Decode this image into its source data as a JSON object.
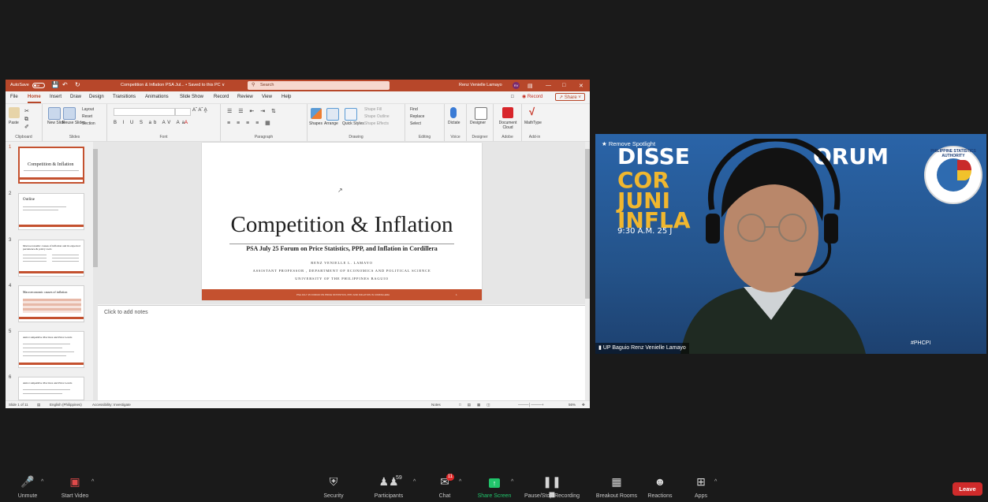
{
  "ppt": {
    "titlebar": {
      "autosave": "AutoSave",
      "autosave_state": "Off",
      "document_title": "Competition & Inflation PSA Jul... • Saved to this PC ∨",
      "search_placeholder": "Search",
      "user_name": "Renz Venielle Lamayo",
      "user_initials": "RV"
    },
    "menu_tabs": [
      "File",
      "Home",
      "Insert",
      "Draw",
      "Design",
      "Transitions",
      "Animations",
      "Slide Show",
      "Record",
      "Review",
      "View",
      "Help"
    ],
    "record_label": "Record",
    "share_label": "Share",
    "ribbon": {
      "paste": "Paste",
      "new_slide": "New Slide",
      "reuse_slides": "Reuse Slides",
      "layout": "Layout",
      "reset": "Reset",
      "section": "Section",
      "shapes": "Shapes",
      "arrange": "Arrange",
      "quick_styles": "Quick Styles",
      "shape_fill": "Shape Fill",
      "shape_outline": "Shape Outline",
      "shape_effects": "Shape Effects",
      "find": "Find",
      "replace": "Replace",
      "select": "Select",
      "dictate": "Dictate",
      "designer": "Designer",
      "document_cloud": "Document Cloud",
      "mathtype": "MathType",
      "groups": [
        "Clipboard",
        "Slides",
        "Font",
        "Paragraph",
        "Drawing",
        "Editing",
        "Voice",
        "Designer",
        "Adobe",
        "Add-in"
      ]
    },
    "thumbnails": [
      {
        "num": "1",
        "title": "Competition & Inflation"
      },
      {
        "num": "2",
        "title": "Outline"
      },
      {
        "num": "3",
        "title": "Macroeconomic causes of inflation and its expected persistence & policy tools"
      },
      {
        "num": "4",
        "title": "Macroeconomic causes of inflation"
      },
      {
        "num": "5",
        "title": "Anti-Competitive Practices and Price Levels"
      },
      {
        "num": "6",
        "title": "Anti-Competitive Practices and Price Levels"
      }
    ],
    "slide": {
      "title": "Competition & Inflation",
      "subtitle": "PSA July 25 Forum on Price Statistics, PPP, and Inflation in Cordillera",
      "author": "RENZ VENIELLE L. LAMAYO",
      "position": "ASSISTANT PROFESSOR , DEPARTMENT OF ECONOMICS AND POLITICAL SCIENCE",
      "university": "UNIVERSITY OF THE PHILIPPINES BAGUIO",
      "footer_text": "PSA JULY 25 FORUM ON PRICE STATISTICS, PPP, AND INFLATION IN CORDILLERA",
      "footer_num": "1"
    },
    "notes_placeholder": "Click to add notes",
    "status": {
      "slide_count": "Slide 1 of 11",
      "language": "English (Philippines)",
      "accessibility": "Accessibility: Investigate",
      "notes": "Notes",
      "zoom": "56%"
    }
  },
  "video": {
    "remove_spotlight": "Remove Spotlight",
    "banner_line1": "DISSE",
    "banner_line1b": "ORUM",
    "banner_line2": "COR",
    "banner_line3": "JUNI",
    "banner_line4": "INFLA",
    "banner_time": "9:30 A.M. 25 J",
    "seal_text": "PHILIPPINE STATISTICS AUTHORITY",
    "participant_name": "UP Baguio Renz Venielle Lamayo",
    "hashtag": "#PHCPI"
  },
  "toolbar": {
    "unmute": "Unmute",
    "start_video": "Start Video",
    "security": "Security",
    "participants": "Participants",
    "participants_count": "59",
    "chat": "Chat",
    "chat_badge": "11",
    "share_screen": "Share Screen",
    "pause_recording": "Pause/Stop Recording",
    "breakout_rooms": "Breakout Rooms",
    "reactions": "Reactions",
    "apps": "Apps",
    "leave": "Leave"
  },
  "colors": {
    "ppt_accent": "#b7472a",
    "share_green": "#21c46b",
    "leave_red": "#cf2b2b",
    "chat_badge_red": "#e02828"
  }
}
